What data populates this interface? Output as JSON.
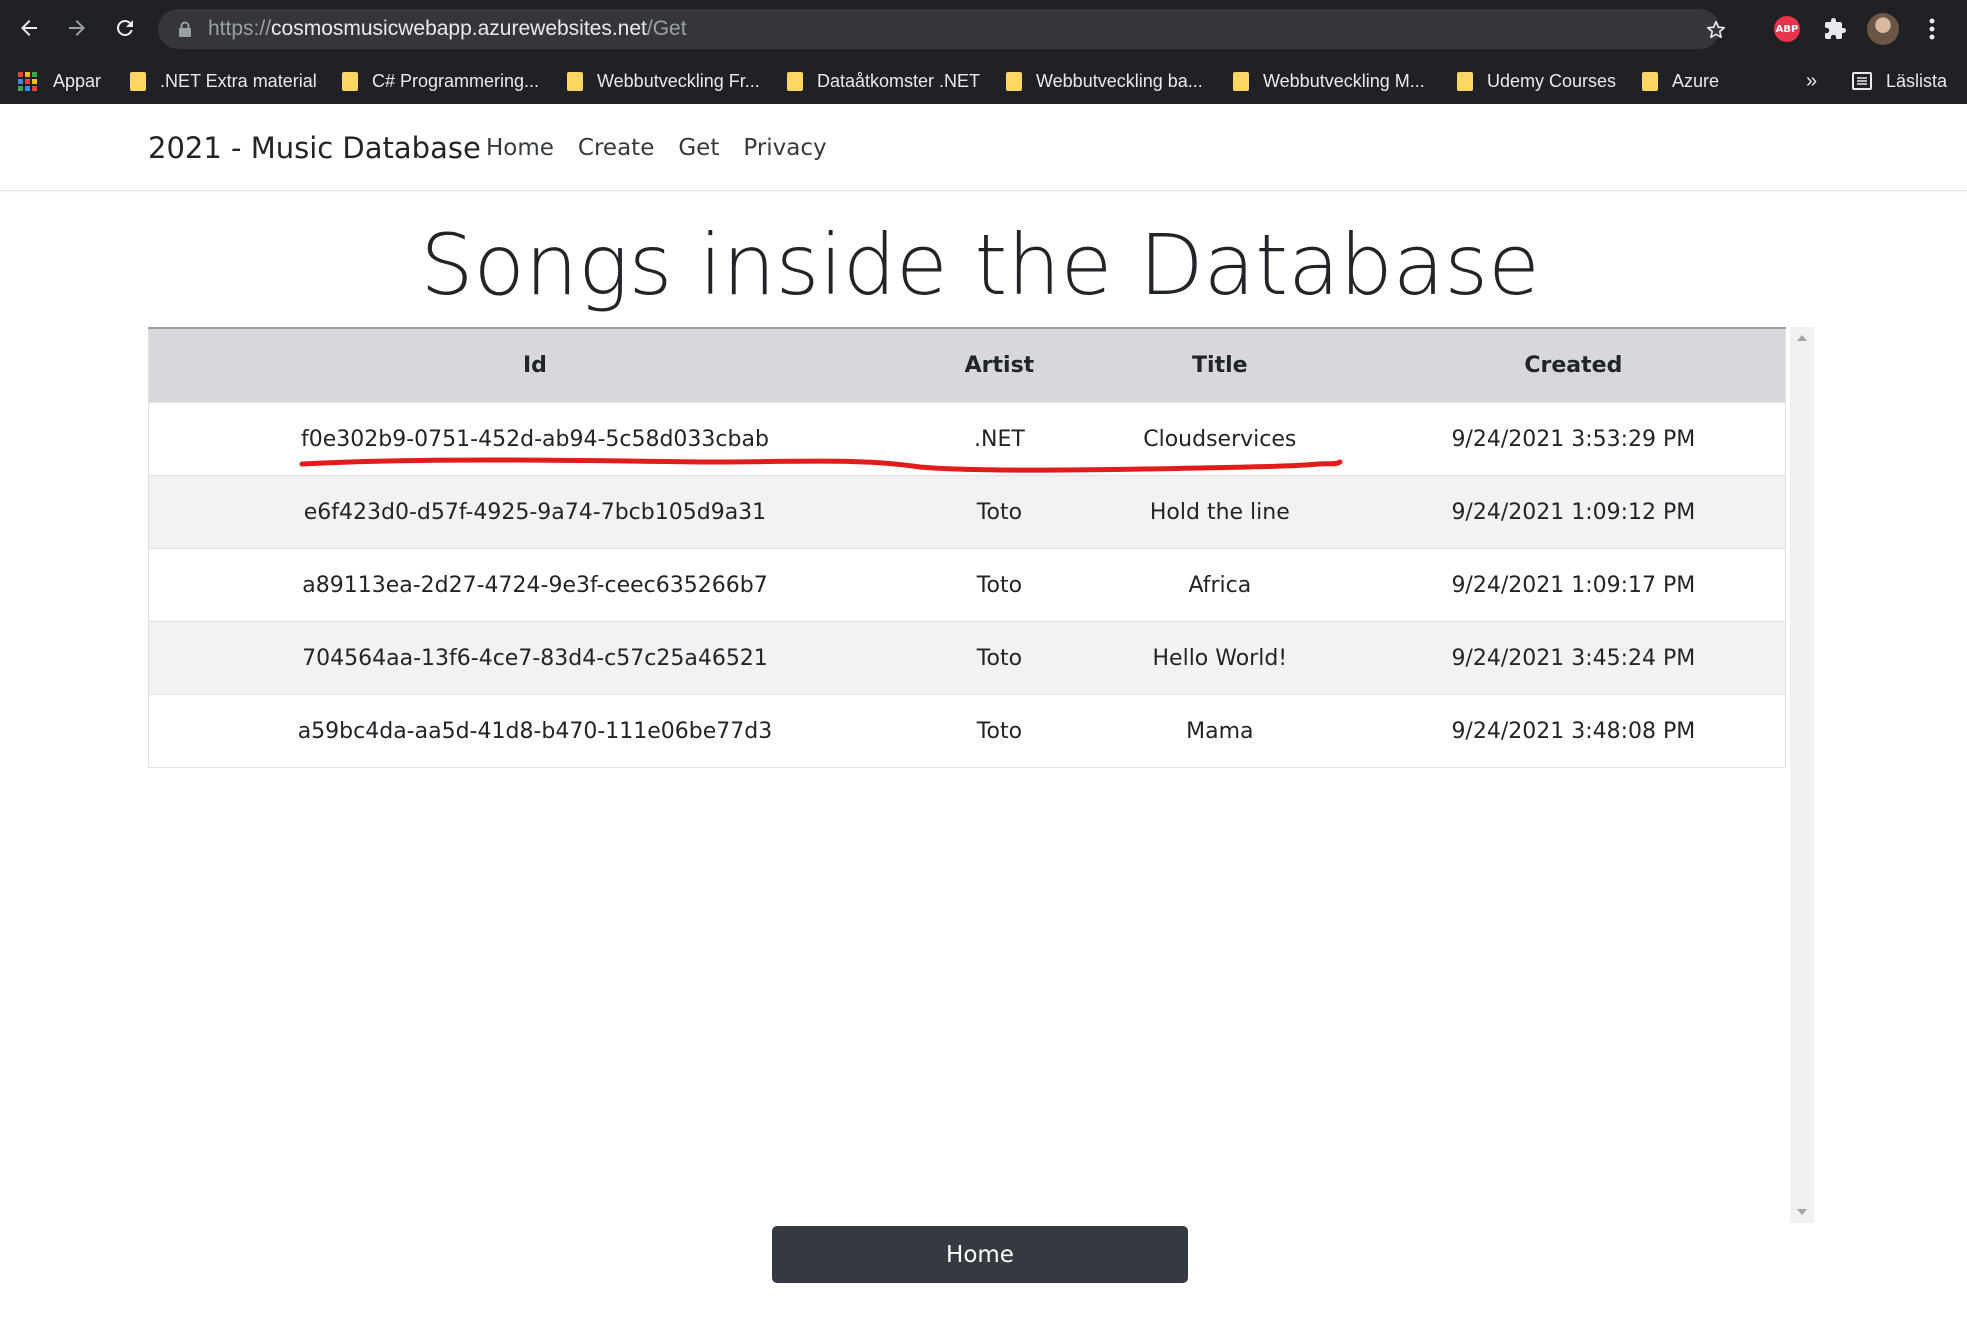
{
  "browser": {
    "url_scheme": "https://",
    "url_host": "cosmosmusicwebapp.azurewebsites.net",
    "url_path": "/Get",
    "reading_list_label": "Läslista",
    "overflow_label": "»",
    "abp_label": "ABP",
    "bookmarks": [
      {
        "label": "Appar",
        "icon": "apps-grid-icon"
      },
      {
        "label": ".NET Extra material",
        "icon": "folder-icon"
      },
      {
        "label": "C# Programmering...",
        "icon": "folder-icon"
      },
      {
        "label": "Webbutveckling Fr...",
        "icon": "folder-icon"
      },
      {
        "label": "Dataåtkomster .NET",
        "icon": "folder-icon"
      },
      {
        "label": "Webbutveckling ba...",
        "icon": "folder-icon"
      },
      {
        "label": "Webbutveckling M...",
        "icon": "folder-icon"
      },
      {
        "label": "Udemy Courses",
        "icon": "folder-icon"
      },
      {
        "label": "Azure",
        "icon": "folder-icon"
      }
    ]
  },
  "navbar": {
    "brand": "2021 - Music Database",
    "links": [
      "Home",
      "Create",
      "Get",
      "Privacy"
    ]
  },
  "page_title": "Songs inside the Database",
  "table": {
    "headers": [
      "Id",
      "Artist",
      "Title",
      "Created"
    ],
    "rows": [
      [
        "f0e302b9-0751-452d-ab94-5c58d033cbab",
        ".NET",
        "Cloudservices",
        "9/24/2021 3:53:29 PM"
      ],
      [
        "e6f423d0-d57f-4925-9a74-7bcb105d9a31",
        "Toto",
        "Hold the line",
        "9/24/2021 1:09:12 PM"
      ],
      [
        "a89113ea-2d27-4724-9e3f-ceec635266b7",
        "Toto",
        "Africa",
        "9/24/2021 1:09:17 PM"
      ],
      [
        "704564aa-13f6-4ce7-83d4-c57c25a46521",
        "Toto",
        "Hello World!",
        "9/24/2021 3:45:24 PM"
      ],
      [
        "a59bc4da-aa5d-41d8-b470-111e06be77d3",
        "Toto",
        "Mama",
        "9/24/2021 3:48:08 PM"
      ]
    ]
  },
  "home_button": "Home",
  "colors": {
    "chrome_bg": "#202124",
    "omnibox_bg": "#35363a",
    "folder": "#fdd663",
    "table_header_bg": "#d6d8db",
    "button_bg": "#343a40",
    "annotation_red": "#e21b1b"
  }
}
